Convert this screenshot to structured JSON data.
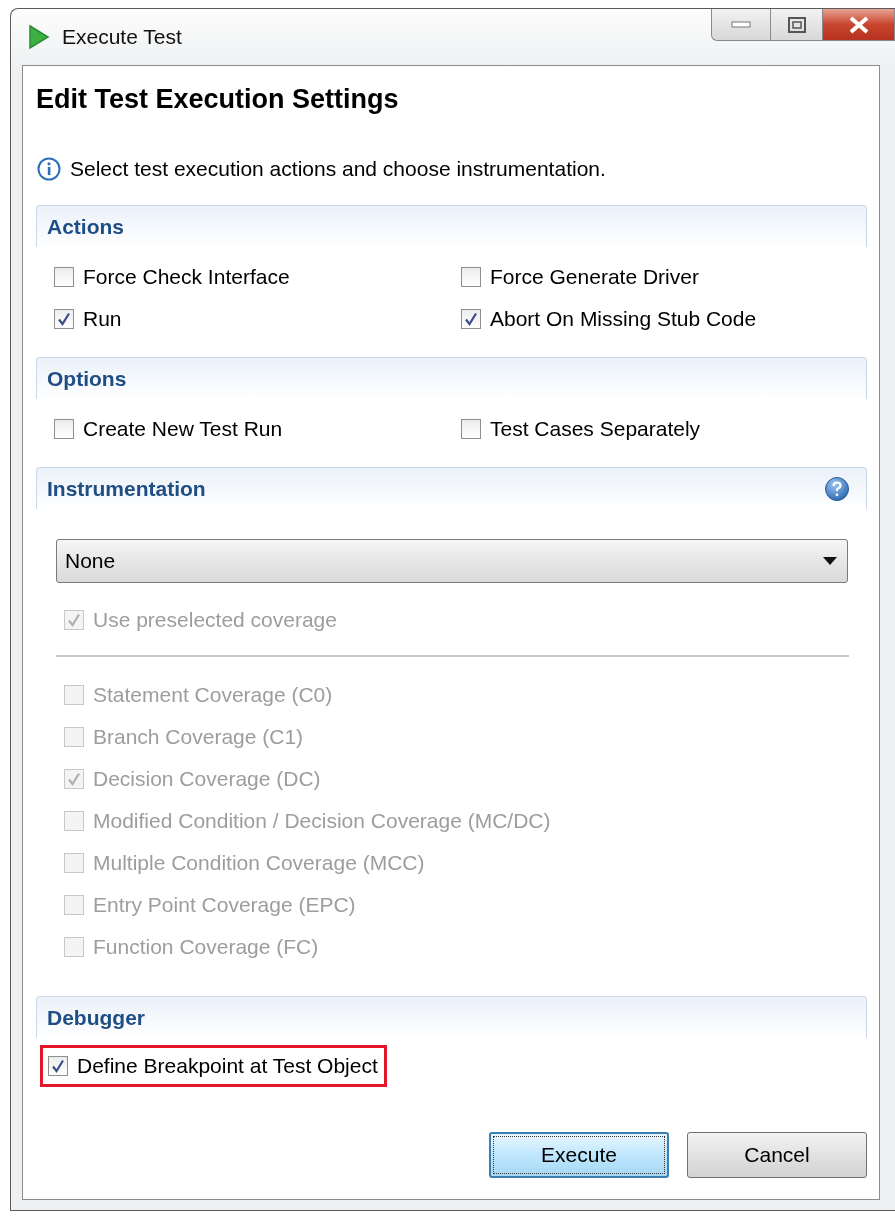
{
  "window": {
    "title": "Execute Test"
  },
  "heading": "Edit Test Execution Settings",
  "info": "Select test execution actions and choose instrumentation.",
  "sections": [
    {
      "title": "Actions",
      "kind": "grid",
      "items": [
        {
          "label": "Force Check Interface",
          "checked": false,
          "disabled": false
        },
        {
          "label": "Force Generate Driver",
          "checked": false,
          "disabled": false
        },
        {
          "label": "Run",
          "checked": true,
          "disabled": false
        },
        {
          "label": "Abort On Missing Stub Code",
          "checked": true,
          "disabled": false
        }
      ]
    },
    {
      "title": "Options",
      "kind": "grid",
      "items": [
        {
          "label": "Create New Test Run",
          "checked": false,
          "disabled": false
        },
        {
          "label": "Test Cases Separately",
          "checked": false,
          "disabled": false
        }
      ]
    },
    {
      "title": "Instrumentation",
      "kind": "instrumentation",
      "dropdown": {
        "value": "None"
      },
      "preselected": {
        "label": "Use preselected coverage",
        "checked": true,
        "disabled": true
      },
      "items": [
        {
          "label": "Statement Coverage (C0)",
          "checked": false,
          "disabled": true
        },
        {
          "label": "Branch Coverage (C1)",
          "checked": false,
          "disabled": true
        },
        {
          "label": "Decision Coverage (DC)",
          "checked": true,
          "disabled": true
        },
        {
          "label": "Modified Condition / Decision Coverage (MC/DC)",
          "checked": false,
          "disabled": true
        },
        {
          "label": "Multiple Condition Coverage (MCC)",
          "checked": false,
          "disabled": true
        },
        {
          "label": "Entry Point Coverage (EPC)",
          "checked": false,
          "disabled": true
        },
        {
          "label": "Function Coverage (FC)",
          "checked": false,
          "disabled": true
        }
      ]
    },
    {
      "title": "Debugger",
      "kind": "list",
      "items": [
        {
          "label": "Define Breakpoint at Test Object",
          "checked": true,
          "disabled": false,
          "highlighted": true
        }
      ]
    }
  ],
  "buttons": [
    {
      "label": "Execute",
      "default": true
    },
    {
      "label": "Cancel",
      "default": false
    }
  ]
}
